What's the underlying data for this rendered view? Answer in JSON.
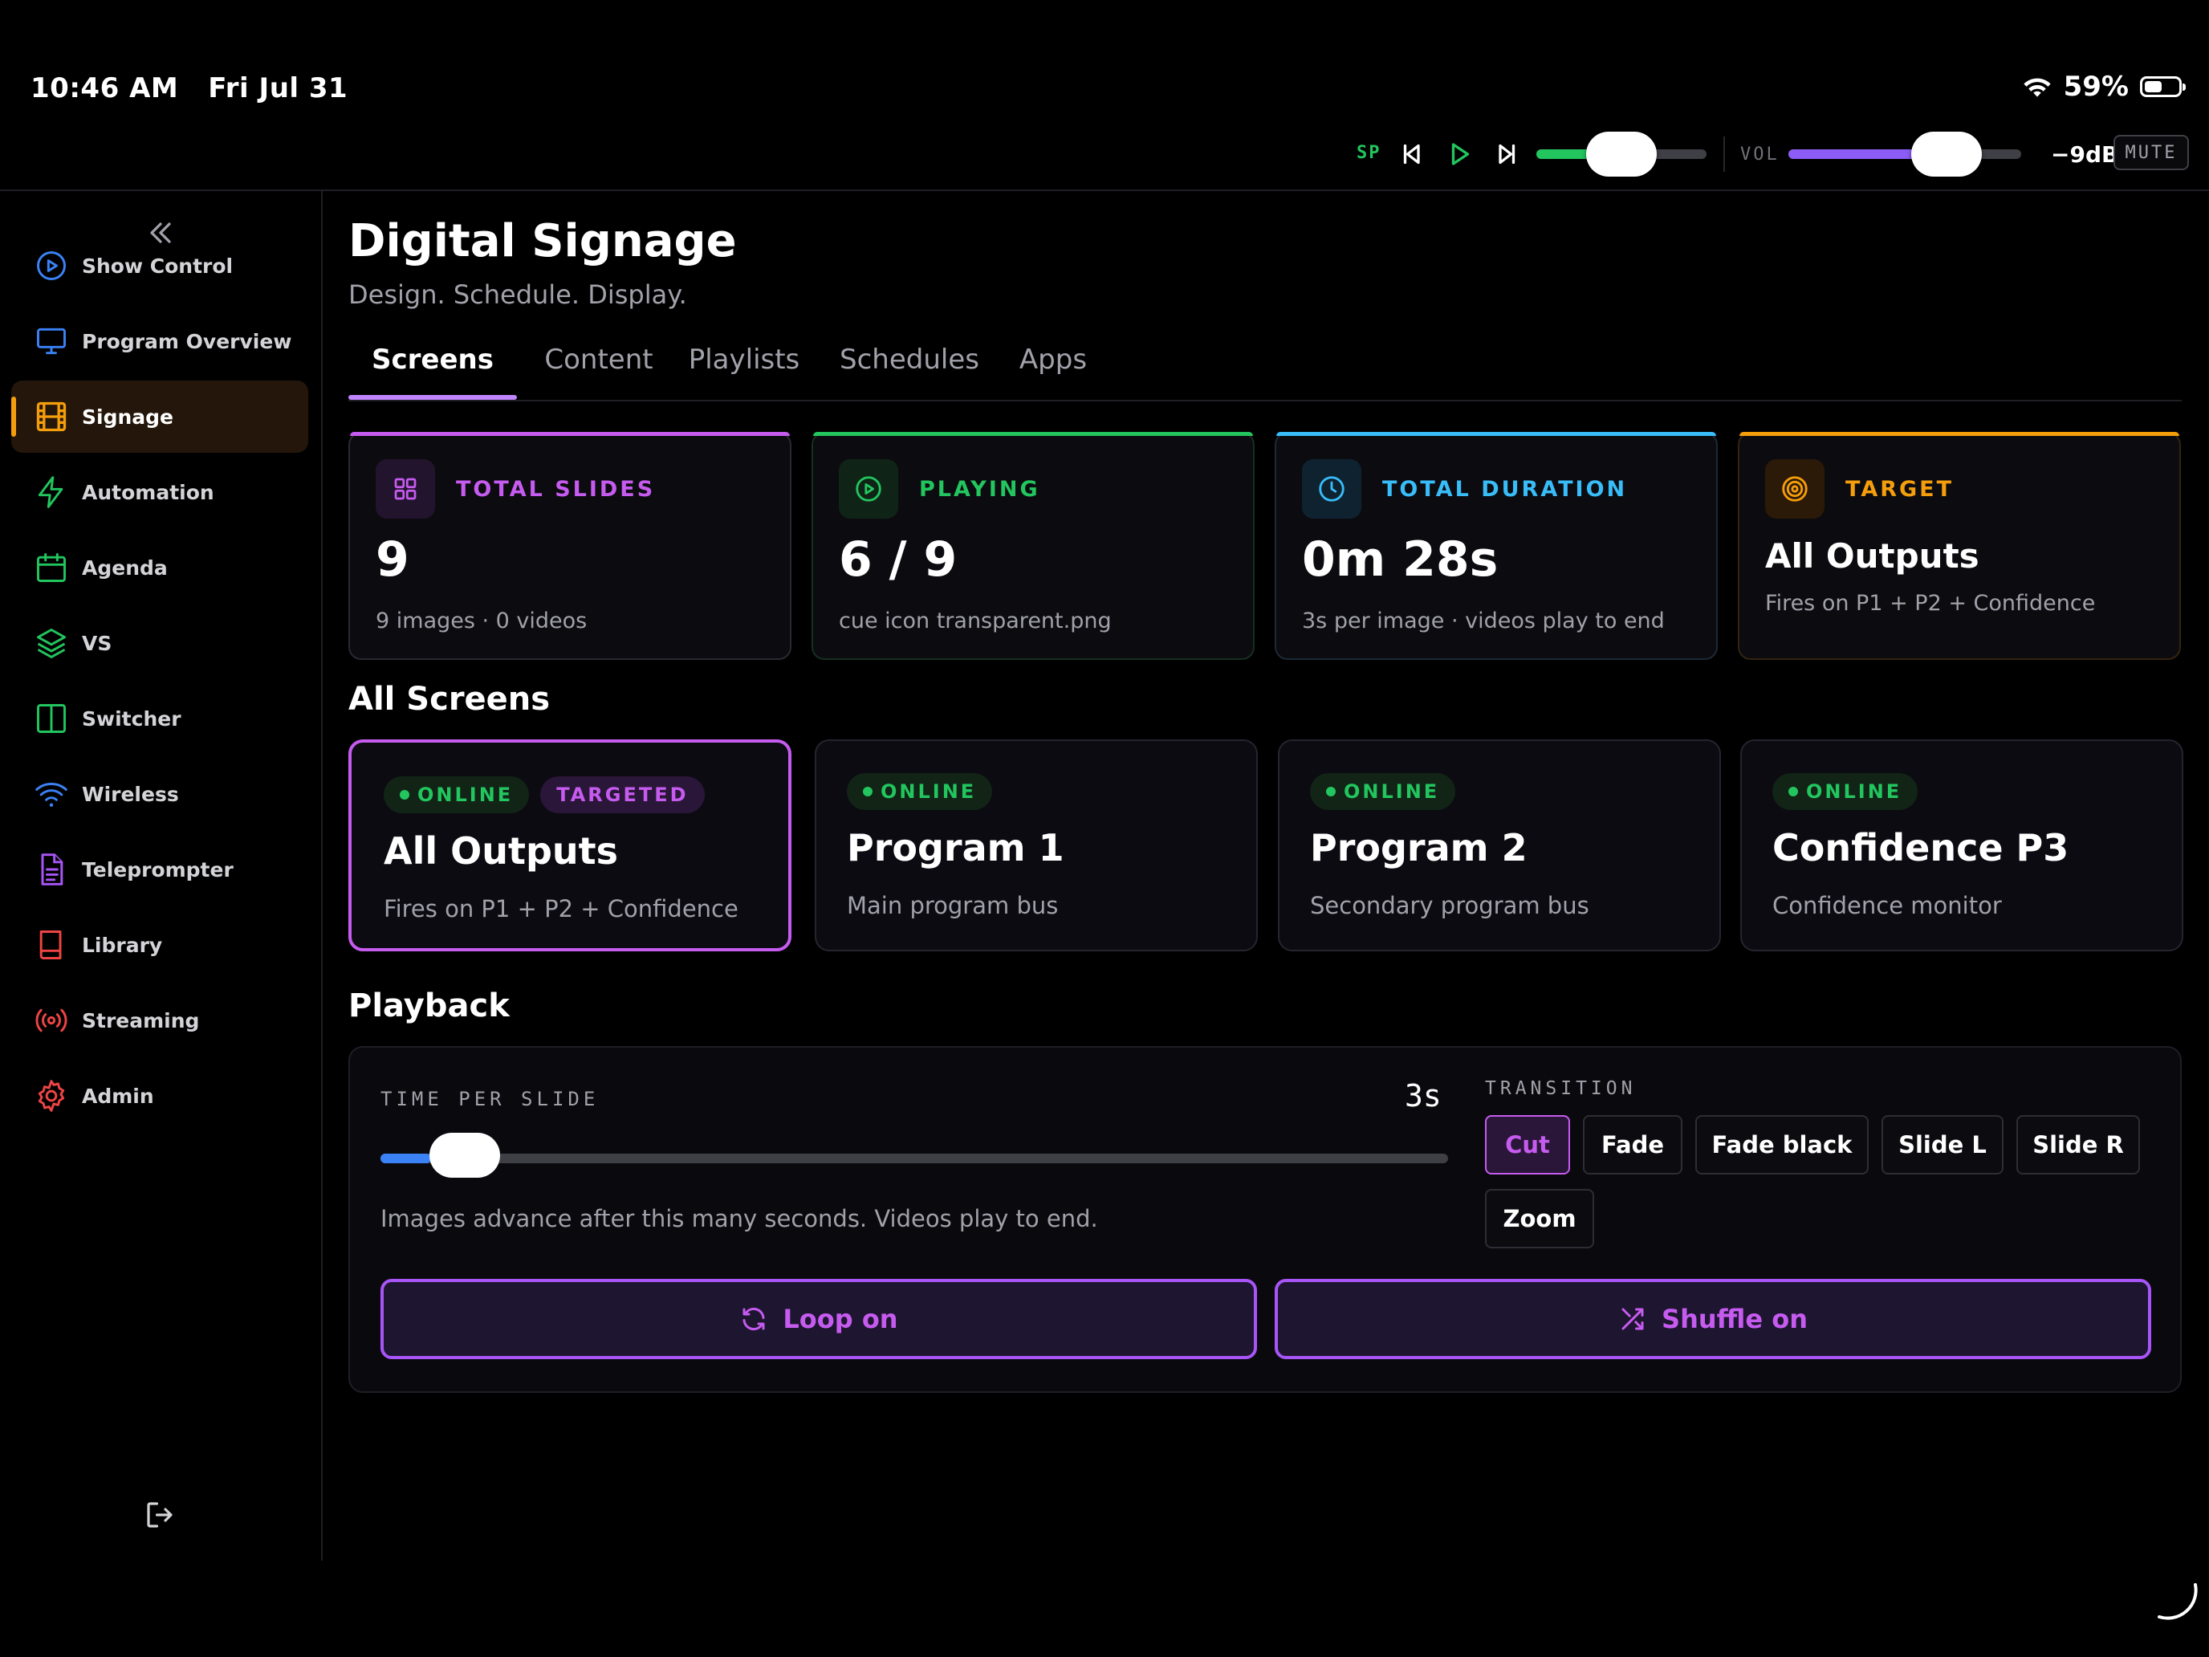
{
  "status_bar": {
    "time": "10:46 AM",
    "date": "Fri Jul 31",
    "battery": "59%",
    "battery_level": 0.59
  },
  "transport": {
    "sp_label": "SP",
    "speed_level": 0.5,
    "vol_label": "VOL",
    "volume_level": 0.68,
    "db": "−9dB",
    "mute_label": "MUTE"
  },
  "sidebar": {
    "items": [
      {
        "label": "Show Control",
        "icon": "play-circle-icon",
        "color": "#3b82f6"
      },
      {
        "label": "Program Overview",
        "icon": "monitor-icon",
        "color": "#3b82f6"
      },
      {
        "label": "Signage",
        "icon": "film-icon",
        "color": "#f59e0b",
        "active": true
      },
      {
        "label": "Automation",
        "icon": "bolt-icon",
        "color": "#22c55e"
      },
      {
        "label": "Agenda",
        "icon": "calendar-icon",
        "color": "#22c55e"
      },
      {
        "label": "VS",
        "icon": "layers-icon",
        "color": "#22c55e"
      },
      {
        "label": "Switcher",
        "icon": "columns-icon",
        "color": "#22c55e"
      },
      {
        "label": "Wireless",
        "icon": "wifi-icon",
        "color": "#3b82f6"
      },
      {
        "label": "Teleprompter",
        "icon": "document-icon",
        "color": "#a855f7"
      },
      {
        "label": "Library",
        "icon": "book-icon",
        "color": "#ef4444"
      },
      {
        "label": "Streaming",
        "icon": "broadcast-icon",
        "color": "#ef4444"
      },
      {
        "label": "Admin",
        "icon": "gear-icon",
        "color": "#ef4444"
      }
    ]
  },
  "page": {
    "title": "Digital Signage",
    "subtitle": "Design. Schedule. Display."
  },
  "tabs": [
    {
      "label": "Screens",
      "active": true
    },
    {
      "label": "Content"
    },
    {
      "label": "Playlists"
    },
    {
      "label": "Schedules"
    },
    {
      "label": "Apps"
    }
  ],
  "stats": [
    {
      "label": "TOTAL SLIDES",
      "value": "9",
      "desc": "9 images · 0 videos",
      "color": "#c65bf0",
      "icon": "grid-icon"
    },
    {
      "label": "PLAYING",
      "value": "6 / 9",
      "desc": "cue icon transparent.png",
      "color": "#22c55e",
      "icon": "play-circle-icon"
    },
    {
      "label": "TOTAL DURATION",
      "value": "0m 28s",
      "desc": "3s per image · videos play to end",
      "color": "#38bdf8",
      "icon": "clock-icon"
    },
    {
      "label": "TARGET",
      "value": "All Outputs",
      "desc": "Fires on P1 + P2 + Confidence",
      "color": "#f59e0b",
      "icon": "target-icon"
    }
  ],
  "screens_section": {
    "title": "All Screens"
  },
  "screens": [
    {
      "status": "ONLINE",
      "targeted": "TARGETED",
      "name": "All Outputs",
      "desc": "Fires on P1 + P2 + Confidence"
    },
    {
      "status": "ONLINE",
      "name": "Program 1",
      "desc": "Main program bus"
    },
    {
      "status": "ONLINE",
      "name": "Program 2",
      "desc": "Secondary program bus"
    },
    {
      "status": "ONLINE",
      "name": "Confidence P3",
      "desc": "Confidence monitor"
    }
  ],
  "playback": {
    "title": "Playback",
    "time_label": "TIME PER SLIDE",
    "time_value": "3s",
    "slider_level": 0.047,
    "help": "Images advance after this many seconds. Videos play to end.",
    "transition_label": "TRANSITION",
    "transitions": [
      {
        "label": "Cut",
        "active": true
      },
      {
        "label": "Fade"
      },
      {
        "label": "Fade black"
      },
      {
        "label": "Slide L"
      },
      {
        "label": "Slide R"
      },
      {
        "label": "Zoom"
      }
    ],
    "loop_label": "Loop on",
    "shuffle_label": "Shuffle on"
  }
}
